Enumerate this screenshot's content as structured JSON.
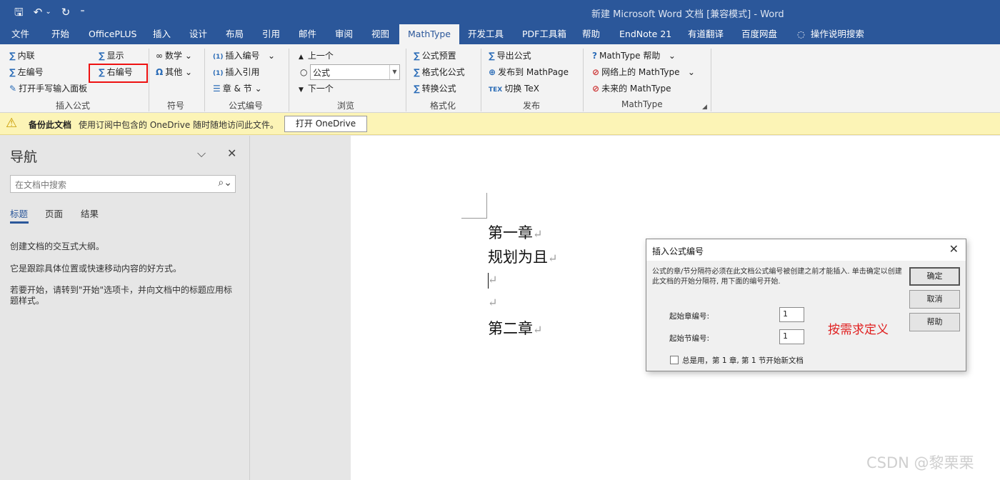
{
  "window": {
    "title": "新建 Microsoft Word 文档 [兼容模式]  -  Word",
    "qat": {
      "save_icon": "🖫",
      "undo_icon": "↶",
      "undo_drop": "⌄",
      "redo_icon": "↻",
      "customize_icon": "⁼"
    }
  },
  "tabs": [
    "文件",
    "开始",
    "OfficePLUS",
    "插入",
    "设计",
    "布局",
    "引用",
    "邮件",
    "审阅",
    "视图",
    "MathType",
    "开发工具",
    "PDF工具箱",
    "帮助",
    "EndNote 21",
    "有道翻译",
    "百度网盘",
    "操作说明搜索"
  ],
  "active_tab": "MathType",
  "ribbon": {
    "insert_equation": {
      "inline": "内联",
      "display": "显示",
      "left_number": "左编号",
      "right_number": "右编号",
      "handwriting": "打开手写输入面板",
      "group": "插入公式"
    },
    "symbols": {
      "math": "数学",
      "other": "其他",
      "group": "符号"
    },
    "equation_numbers": {
      "insert_number": "插入编号",
      "insert_reference": "插入引用",
      "chapter_section": "章 & 节",
      "group": "公式编号"
    },
    "browse": {
      "prev": "上一个",
      "combo_value": "公式",
      "next": "下一个",
      "group": "浏览"
    },
    "format": {
      "presets": "公式预置",
      "format_equations": "格式化公式",
      "convert": "转换公式",
      "group": "格式化"
    },
    "publish": {
      "export": "导出公式",
      "mathpage": "发布到 MathPage",
      "toggle_tex": "切换 TeX",
      "group": "发布"
    },
    "mathtype": {
      "help": "MathType 帮助",
      "online": "网络上的 MathType",
      "future": "未来的 MathType",
      "group": "MathType"
    }
  },
  "infobar": {
    "title": "备份此文档",
    "message": "使用订阅中包含的 OneDrive 随时随地访问此文件。",
    "button": "打开 OneDrive"
  },
  "nav": {
    "title": "导航",
    "search_placeholder": "在文档中搜索",
    "tabs": [
      "标题",
      "页面",
      "结果"
    ],
    "p1": "创建文档的交互式大纲。",
    "p2": "它是跟踪具体位置或快速移动内容的好方式。",
    "p3": "若要开始，请转到\"开始\"选项卡，并向文档中的标题应用标题样式。"
  },
  "document": {
    "lines": [
      "第一章",
      "规划为且",
      "",
      "",
      "第二章"
    ],
    "paragraph_mark": "↵"
  },
  "dialog": {
    "title": "插入公式编号",
    "description": "公式的章/节分隔符必须在此文档公式编号被创建之前才能插入. 单击确定以创建此文档的开始分隔符, 用下面的编号开始.",
    "chapter_label": "起始章编号:",
    "chapter_value": "1",
    "section_label": "起始节编号:",
    "section_value": "1",
    "checkbox_label": "总是用，第 1 章, 第 1 节开始新文档",
    "ok": "确定",
    "cancel": "取消",
    "help": "帮助",
    "annotation": "按需求定义"
  },
  "watermark": "CSDN @黎栗栗",
  "colors": {
    "accent": "#2b579a",
    "infobar": "#fcf4b6",
    "highlight": "#e11111",
    "annotation": "#e02020"
  }
}
